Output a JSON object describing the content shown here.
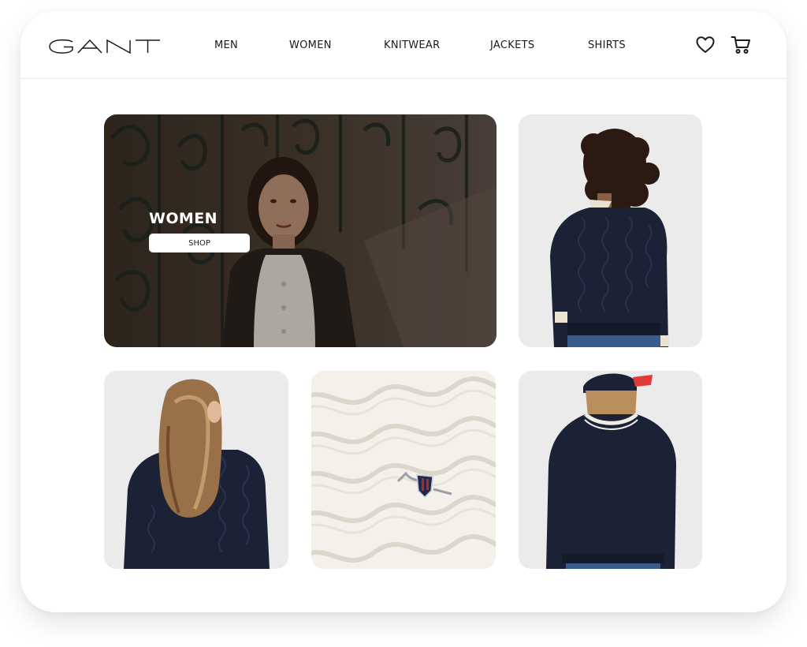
{
  "brand": {
    "logo_text": "GANT"
  },
  "nav": {
    "items": [
      {
        "label": "MEN"
      },
      {
        "label": "WOMEN"
      },
      {
        "label": "KNITWEAR"
      },
      {
        "label": "JACKETS"
      },
      {
        "label": "SHIRTS"
      }
    ]
  },
  "header_icons": {
    "wishlist": "heart-icon",
    "cart": "cart-icon"
  },
  "hero": {
    "title": "WOMEN",
    "button_label": "SHOP"
  },
  "colors": {
    "navy_knit": "#1c2236",
    "cream_knit": "#f4f1ea",
    "tile_background": "#ececec",
    "text_dark": "#1a1a1a",
    "divider": "#e8e8ea"
  }
}
